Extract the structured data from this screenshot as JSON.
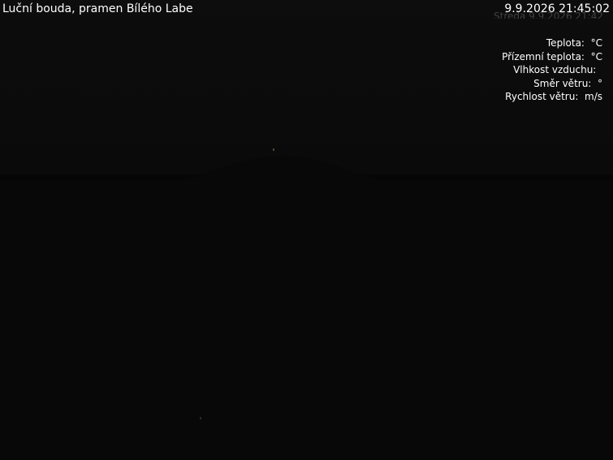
{
  "overlay": {
    "title": "Luční bouda, pramen Bílého Labe",
    "timestamp": "9.9.2026 21:45:02",
    "ghost_line": "Středa  9.9.2026 21:42",
    "weather": [
      {
        "label": "Teplota:",
        "unit": "°C"
      },
      {
        "label": "Přízemní teplota:",
        "unit": "°C"
      },
      {
        "label": "Vlhkost vzduchu:",
        "unit": ""
      },
      {
        "label": "Směr větru:",
        "unit": "°"
      },
      {
        "label": "Rychlost větru:",
        "unit": "m/s"
      }
    ]
  }
}
